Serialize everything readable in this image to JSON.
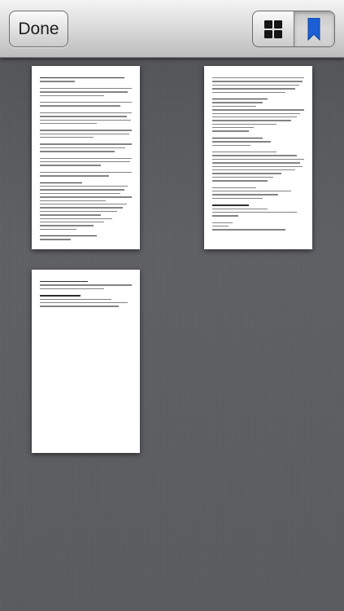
{
  "toolbar": {
    "done_label": "Done",
    "view_toggle": {
      "items": [
        {
          "name": "grid",
          "icon": "grid-icon",
          "active": false
        },
        {
          "name": "bookmarks",
          "icon": "bookmark-icon",
          "active": true
        }
      ],
      "bookmark_color": "#1b5fd6"
    }
  },
  "pages": [
    {
      "page": 1
    },
    {
      "page": 2
    },
    {
      "page": 3
    }
  ],
  "colors": {
    "background": "#5b5d61",
    "page": "#ffffff",
    "accent": "#1b5fd6"
  }
}
